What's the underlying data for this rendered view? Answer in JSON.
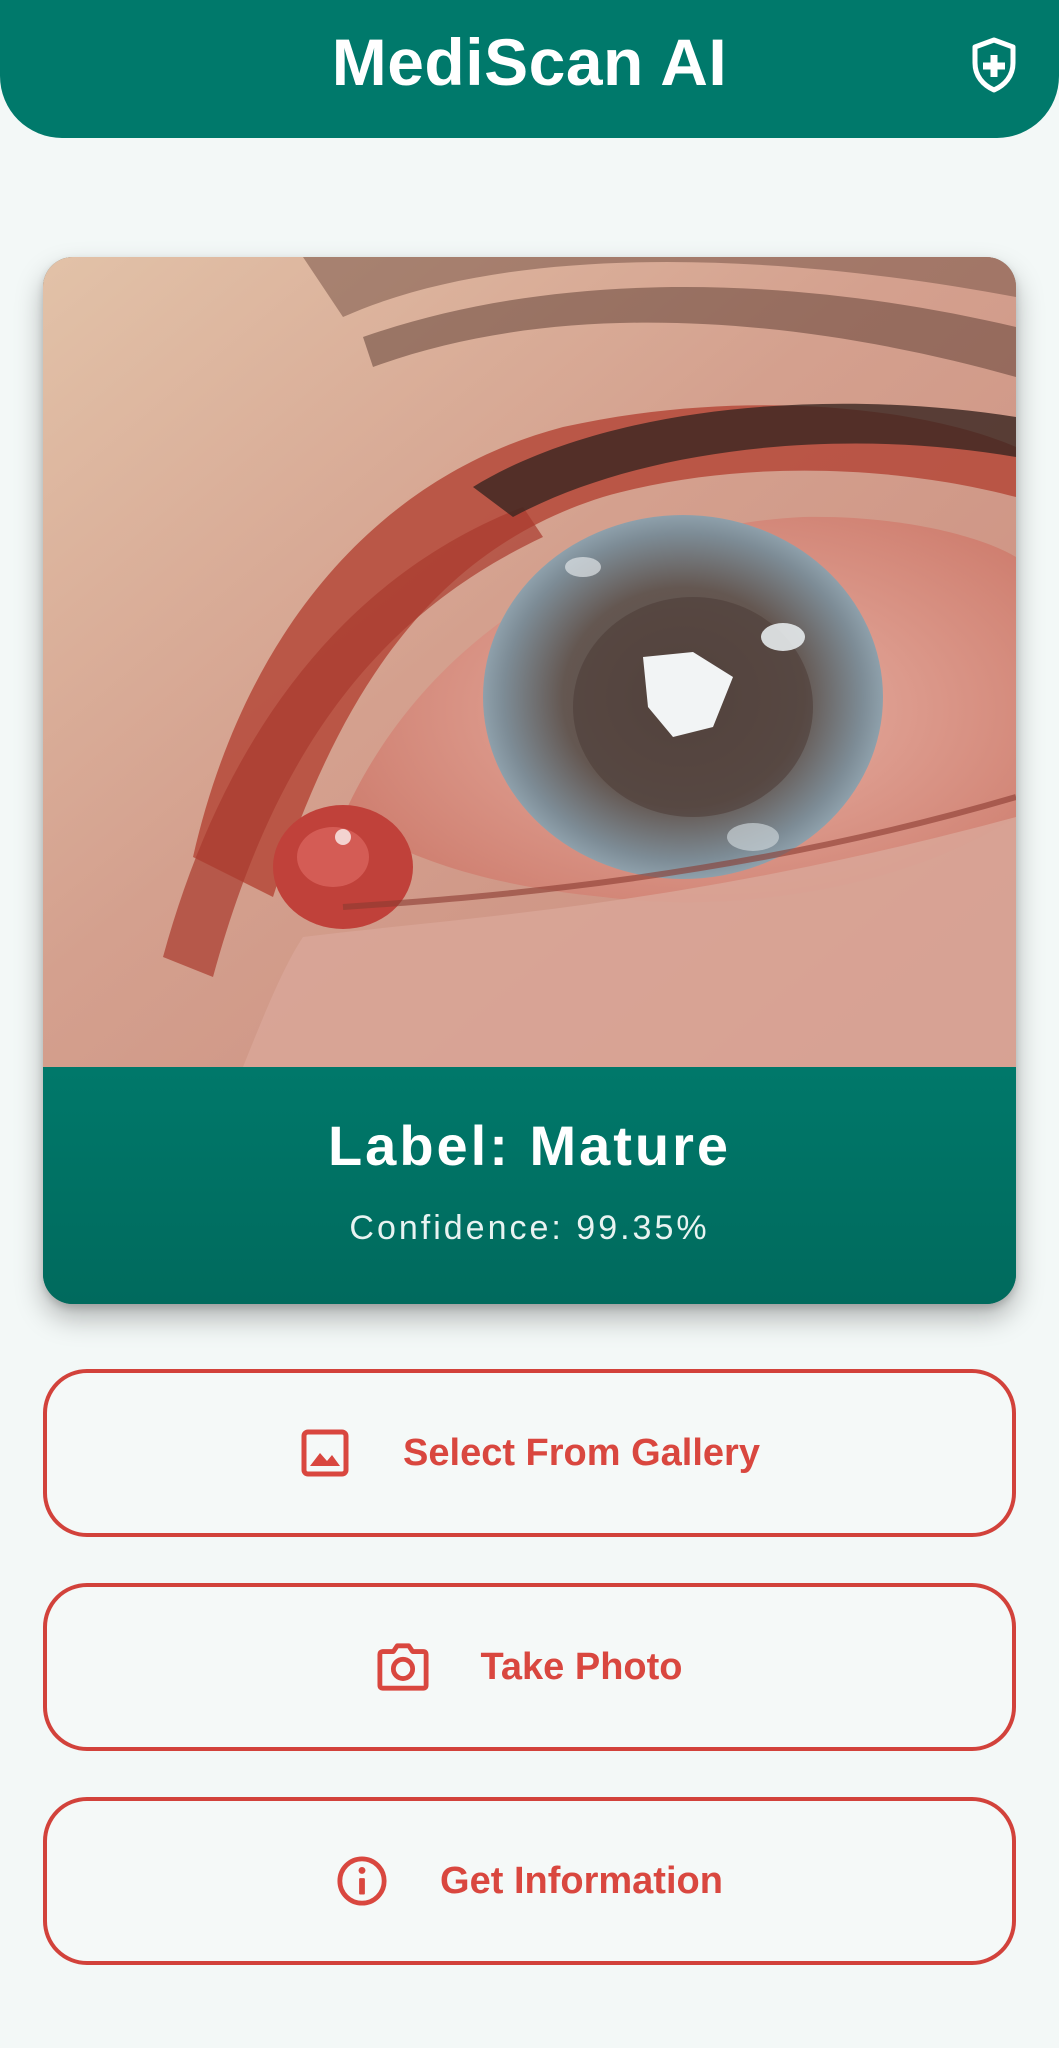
{
  "header": {
    "title": "MediScan AI",
    "icon": "shield-plus-icon"
  },
  "result": {
    "label_text": "Label: Mature",
    "confidence_text": "Confidence: 99.35%"
  },
  "buttons": {
    "gallery": {
      "label": "Select From Gallery",
      "icon": "image-icon"
    },
    "photo": {
      "label": "Take Photo",
      "icon": "camera-icon"
    },
    "info": {
      "label": "Get Information",
      "icon": "info-icon"
    }
  },
  "colors": {
    "primary": "#00796b",
    "accent": "#d2423b",
    "background": "#f3f8f7"
  }
}
